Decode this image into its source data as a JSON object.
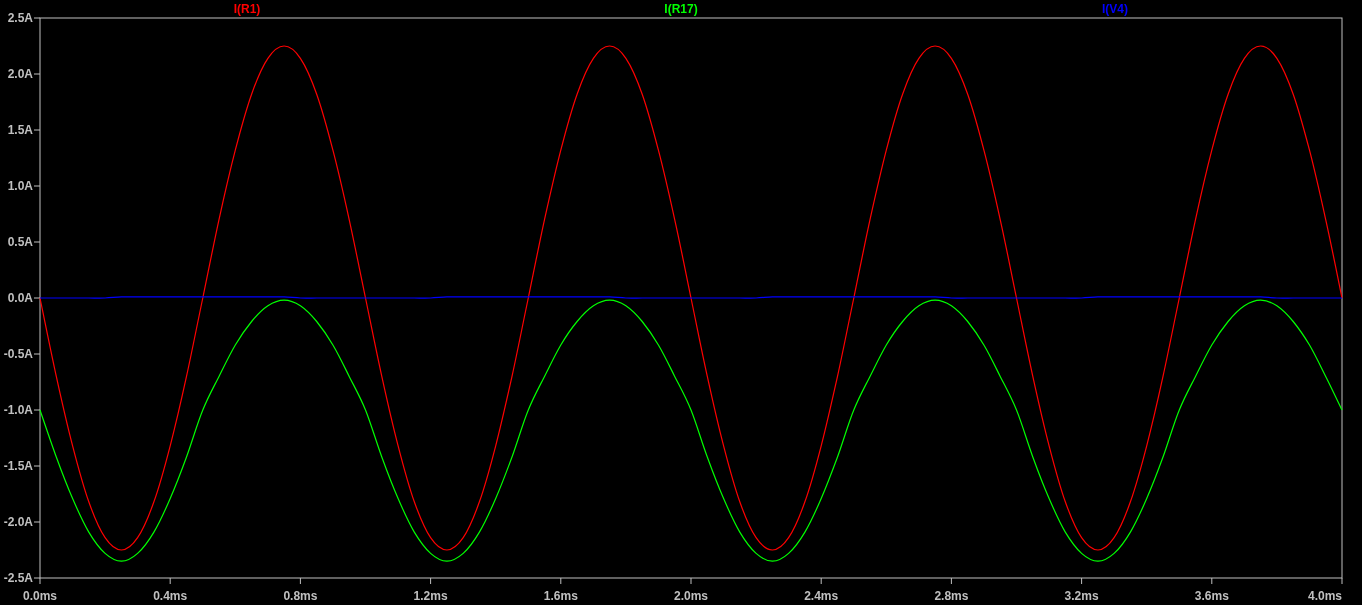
{
  "plot": {
    "chart_data": {
      "type": "line",
      "xlim": [
        0,
        4
      ],
      "ylim": [
        -2.5,
        2.5
      ],
      "xticks": [
        {
          "value": 0,
          "label": "0.0ms"
        },
        {
          "value": 0.4,
          "label": "0.4ms"
        },
        {
          "value": 0.8,
          "label": "0.8ms"
        },
        {
          "value": 1.2,
          "label": "1.2ms"
        },
        {
          "value": 1.6,
          "label": "1.6ms"
        },
        {
          "value": 2.0,
          "label": "2.0ms"
        },
        {
          "value": 2.4,
          "label": "2.4ms"
        },
        {
          "value": 2.8,
          "label": "2.8ms"
        },
        {
          "value": 3.2,
          "label": "3.2ms"
        },
        {
          "value": 3.6,
          "label": "3.6ms"
        },
        {
          "value": 4.0,
          "label": "4.0ms"
        }
      ],
      "yticks": [
        {
          "value": 2.5,
          "label": "2.5A"
        },
        {
          "value": 2.0,
          "label": "2.0A"
        },
        {
          "value": 1.5,
          "label": "1.5A"
        },
        {
          "value": 1.0,
          "label": "1.0A"
        },
        {
          "value": 0.5,
          "label": "0.5A"
        },
        {
          "value": 0,
          "label": "0.0A"
        },
        {
          "value": -0.5,
          "label": "-0.5A"
        },
        {
          "value": -1.0,
          "label": "-1.0A"
        },
        {
          "value": -1.5,
          "label": "-1.5A"
        },
        {
          "value": -2.0,
          "label": "-2.0A"
        },
        {
          "value": -2.5,
          "label": "-2.5A"
        }
      ],
      "x": [
        0,
        0.05,
        0.1,
        0.15,
        0.2,
        0.25,
        0.3,
        0.35,
        0.4,
        0.45,
        0.5,
        0.55,
        0.6,
        0.65,
        0.7,
        0.75,
        0.8,
        0.85,
        0.9,
        0.95,
        1,
        1.05,
        1.1,
        1.15,
        1.2,
        1.25,
        1.3,
        1.35,
        1.4,
        1.45,
        1.5,
        1.55,
        1.6,
        1.65,
        1.7,
        1.75,
        1.8,
        1.85,
        1.9,
        1.95,
        2,
        2.05,
        2.1,
        2.15,
        2.2,
        2.25,
        2.3,
        2.35,
        2.4,
        2.45,
        2.5,
        2.55,
        2.6,
        2.65,
        2.7,
        2.75,
        2.8,
        2.85,
        2.9,
        2.95,
        3,
        3.05,
        3.1,
        3.15,
        3.2,
        3.25,
        3.3,
        3.35,
        3.4,
        3.45,
        3.5,
        3.55,
        3.6,
        3.65,
        3.7,
        3.75,
        3.8,
        3.85,
        3.9,
        3.95,
        4
      ],
      "series": [
        {
          "name": "I(R1)",
          "color": "#ff0000",
          "values": [
            0,
            -0.7,
            -1.32,
            -1.82,
            -2.14,
            -2.25,
            -2.14,
            -1.82,
            -1.32,
            -0.7,
            0,
            0.7,
            1.32,
            1.82,
            2.14,
            2.25,
            2.14,
            1.82,
            1.32,
            0.7,
            0,
            -0.7,
            -1.32,
            -1.82,
            -2.14,
            -2.25,
            -2.14,
            -1.82,
            -1.32,
            -0.7,
            0,
            0.7,
            1.32,
            1.82,
            2.14,
            2.25,
            2.14,
            1.82,
            1.32,
            0.7,
            0,
            -0.7,
            -1.32,
            -1.82,
            -2.14,
            -2.25,
            -2.14,
            -1.82,
            -1.32,
            -0.7,
            0,
            0.7,
            1.32,
            1.82,
            2.14,
            2.25,
            2.14,
            1.82,
            1.32,
            0.7,
            0,
            -0.7,
            -1.32,
            -1.82,
            -2.14,
            -2.25,
            -2.14,
            -1.82,
            -1.32,
            -0.7,
            0,
            0.7,
            1.32,
            1.82,
            2.14,
            2.25,
            2.14,
            1.82,
            1.32,
            0.7,
            0
          ]
        },
        {
          "name": "I(R17)",
          "color": "#00ff00",
          "values": [
            -1,
            -1.42,
            -1.79,
            -2.09,
            -2.28,
            -2.35,
            -2.28,
            -2.09,
            -1.79,
            -1.42,
            -1,
            -0.7,
            -0.42,
            -0.21,
            -0.07,
            -0.02,
            -0.07,
            -0.21,
            -0.42,
            -0.7,
            -1,
            -1.42,
            -1.79,
            -2.09,
            -2.28,
            -2.35,
            -2.28,
            -2.09,
            -1.79,
            -1.42,
            -1,
            -0.7,
            -0.42,
            -0.21,
            -0.07,
            -0.02,
            -0.07,
            -0.21,
            -0.42,
            -0.7,
            -1,
            -1.42,
            -1.79,
            -2.09,
            -2.28,
            -2.35,
            -2.28,
            -2.09,
            -1.79,
            -1.42,
            -1,
            -0.7,
            -0.42,
            -0.21,
            -0.07,
            -0.02,
            -0.07,
            -0.21,
            -0.42,
            -0.7,
            -1,
            -1.42,
            -1.79,
            -2.09,
            -2.28,
            -2.35,
            -2.28,
            -2.09,
            -1.79,
            -1.42,
            -1,
            -0.7,
            -0.42,
            -0.21,
            -0.07,
            -0.02,
            -0.07,
            -0.21,
            -0.42,
            -0.7,
            -1
          ]
        },
        {
          "name": "I(V4)",
          "color": "#0000ff",
          "values": [
            0,
            0,
            0,
            0,
            0,
            0.01,
            0.01,
            0.01,
            0.01,
            0.01,
            0.01,
            0.01,
            0.01,
            0.01,
            0.01,
            0.01,
            0,
            0,
            0,
            0,
            0,
            0,
            0,
            0,
            0,
            0.01,
            0.01,
            0.01,
            0.01,
            0.01,
            0.01,
            0.01,
            0.01,
            0.01,
            0.01,
            0.01,
            0,
            0,
            0,
            0,
            0,
            0,
            0,
            0,
            0,
            0.01,
            0.01,
            0.01,
            0.01,
            0.01,
            0.01,
            0.01,
            0.01,
            0.01,
            0.01,
            0.01,
            0,
            0,
            0,
            0,
            0,
            0,
            0,
            0,
            0,
            0.01,
            0.01,
            0.01,
            0.01,
            0.01,
            0.01,
            0.01,
            0.01,
            0.01,
            0.01,
            0.01,
            0,
            0,
            0,
            0,
            0
          ]
        }
      ]
    }
  }
}
